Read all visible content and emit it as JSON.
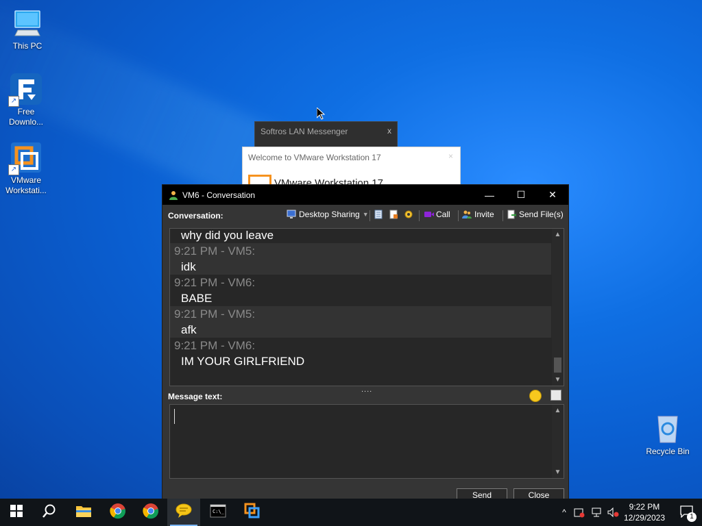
{
  "desktop": {
    "icons": [
      {
        "label": "This PC",
        "icon": "this-pc-icon"
      },
      {
        "label": "Free\nDownlo...",
        "icon": "free-download-manager-icon"
      },
      {
        "label": "VMware\nWorkstati...",
        "icon": "vmware-workstation-icon"
      },
      {
        "label": "Recycle Bin",
        "icon": "recycle-bin-icon"
      }
    ]
  },
  "background_windows": {
    "softros_title": "Softros LAN Messenger",
    "softros_close": "x",
    "welcome_title": "Welcome to VMware Workstation 17",
    "welcome_heading": "VMware Workstation 17",
    "welcome_close": "×"
  },
  "conversation": {
    "title": "VM6 - Conversation",
    "controls": {
      "minimize": "—",
      "maximize": "☐",
      "close": "✕"
    },
    "toolbar": {
      "label": "Conversation:",
      "desktop_sharing": "Desktop Sharing",
      "call": "Call",
      "invite": "Invite",
      "send_files": "Send File(s)"
    },
    "first_line": "why did you leave",
    "messages": [
      {
        "header": "9:21 PM - VM5:",
        "text": "idk"
      },
      {
        "header": "9:21 PM - VM6:",
        "text": "BABE"
      },
      {
        "header": "9:21 PM - VM5:",
        "text": "afk"
      },
      {
        "header": "9:21 PM - VM6:",
        "text": "IM YOUR GIRLFRIEND"
      }
    ],
    "splitter": "....",
    "message_label": "Message text:",
    "message_value": "",
    "send_label": "Send",
    "close_label": "Close"
  },
  "taskbar": {
    "apps": [
      "start-icon",
      "search-icon",
      "file-explorer-icon",
      "chrome-icon",
      "chrome-icon",
      "softros-messenger-icon",
      "terminal-icon",
      "vmware-workstation-icon"
    ],
    "time": "9:22 PM",
    "date": "12/29/2023",
    "notification_count": "1",
    "colors": {
      "taskbar": "#101418",
      "accent": "#7db8ff"
    }
  }
}
